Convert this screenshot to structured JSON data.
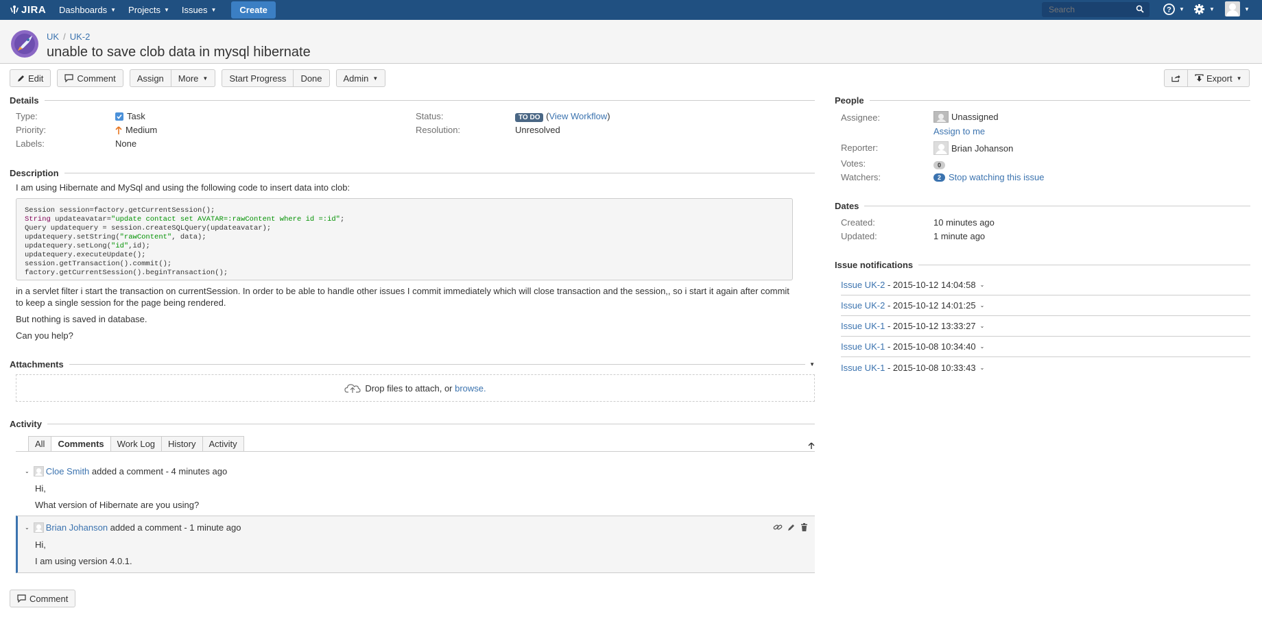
{
  "topnav": {
    "logo": "JIRA",
    "items": [
      {
        "label": "Dashboards"
      },
      {
        "label": "Projects"
      },
      {
        "label": "Issues"
      }
    ],
    "create_label": "Create",
    "search_placeholder": "Search",
    "help_icon": "help-icon",
    "settings_icon": "gear-icon",
    "brand_color": "#205081"
  },
  "header": {
    "breadcrumb": {
      "project": "UK",
      "sep": "/",
      "issue": "UK-2"
    },
    "title": "unable to save clob data in mysql hibernate"
  },
  "toolbar": {
    "edit": "Edit",
    "comment": "Comment",
    "assign": "Assign",
    "more": "More",
    "start_progress": "Start Progress",
    "done": "Done",
    "admin": "Admin",
    "export": "Export"
  },
  "details": {
    "heading": "Details",
    "type_label": "Type:",
    "type_value": "Task",
    "priority_label": "Priority:",
    "priority_value": "Medium",
    "labels_label": "Labels:",
    "labels_value": "None",
    "status_label": "Status:",
    "status_value": "TO DO",
    "view_workflow": "View Workflow",
    "resolution_label": "Resolution:",
    "resolution_value": "Unresolved"
  },
  "description": {
    "heading": "Description",
    "intro": "I am using Hibernate and MySql and using the following code to insert data into clob:",
    "code_lines": [
      "Session session=factory.getCurrentSession();",
      "String updateavatar=\"update contact set AVATAR=:rawContent where id =:id\";",
      "Query updatequery = session.createSQLQuery(updateavatar);",
      "updatequery.setString(\"rawContent\", data);",
      "updatequery.setLong(\"id\",id);",
      "updatequery.executeUpdate();",
      "session.getTransaction().commit();",
      "factory.getCurrentSession().beginTransaction();"
    ],
    "para1": "in a servlet filter i start the transaction on currentSession. In order to be able to handle other issues I commit immediately which will close transaction and the session,, so i start it again after commit to keep a single session for the page being rendered.",
    "para2": "But nothing is saved in database.",
    "para3": "Can you help?"
  },
  "attachments": {
    "heading": "Attachments",
    "drop_text": "Drop files to attach, or",
    "browse": "browse."
  },
  "activity": {
    "heading": "Activity",
    "tabs": [
      "All",
      "Comments",
      "Work Log",
      "History",
      "Activity"
    ],
    "active_tab": "Comments",
    "comments": [
      {
        "author": "Cloe Smith",
        "meta": "added a comment - 4 minutes ago",
        "lines": [
          "Hi,",
          "What version of Hibernate are you using?"
        ]
      },
      {
        "author": "Brian Johanson",
        "meta": "added a comment - 1 minute ago",
        "lines": [
          "Hi,",
          "I am using version 4.0.1."
        ]
      }
    ],
    "comment_button": "Comment"
  },
  "people": {
    "heading": "People",
    "assignee_label": "Assignee:",
    "assignee_value": "Unassigned",
    "assign_to_me": "Assign to me",
    "reporter_label": "Reporter:",
    "reporter_value": "Brian Johanson",
    "votes_label": "Votes:",
    "votes_count": "0",
    "watchers_label": "Watchers:",
    "watchers_count": "2",
    "stop_watching": "Stop watching this issue"
  },
  "dates": {
    "heading": "Dates",
    "created_label": "Created:",
    "created_value": "10 minutes ago",
    "updated_label": "Updated:",
    "updated_value": "1 minute ago"
  },
  "notifications": {
    "heading": "Issue notifications",
    "items": [
      {
        "issue": "Issue UK-2",
        "date": "- 2015-10-12 14:04:58"
      },
      {
        "issue": "Issue UK-2",
        "date": "- 2015-10-12 14:01:25"
      },
      {
        "issue": "Issue UK-1",
        "date": "- 2015-10-12 13:33:27"
      },
      {
        "issue": "Issue UK-1",
        "date": "- 2015-10-08 10:34:40"
      },
      {
        "issue": "Issue UK-1",
        "date": "- 2015-10-08 10:33:43"
      }
    ]
  }
}
